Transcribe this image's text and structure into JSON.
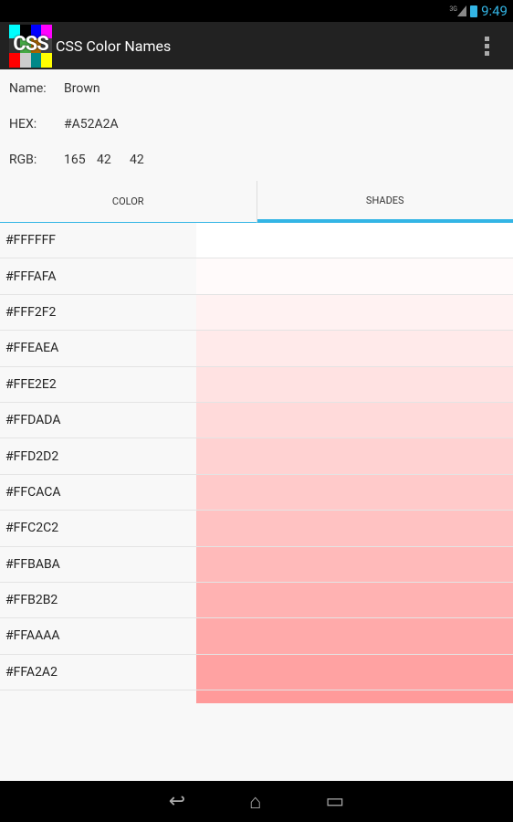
{
  "status": {
    "network": "3G",
    "time": "9:49"
  },
  "app": {
    "title": "CSS Color Names",
    "logo_text": "CSS"
  },
  "info": {
    "name_label": "Name:",
    "name": "Brown",
    "hex_label": "HEX:",
    "hex": "#A52A2A",
    "rgb_label": "RGB:",
    "r": "165",
    "g": "42",
    "b": "42"
  },
  "tabs": [
    {
      "label": "COLOR",
      "active": false
    },
    {
      "label": "SHADES",
      "active": true
    }
  ],
  "accent": "#33b5e5",
  "shades": [
    "#FFFFFF",
    "#FFFAFA",
    "#FFF2F2",
    "#FFEAEA",
    "#FFE2E2",
    "#FFDADA",
    "#FFD2D2",
    "#FFCACA",
    "#FFC2C2",
    "#FFBABA",
    "#FFB2B2",
    "#FFAAAA",
    "#FFA2A2"
  ],
  "partial_shade_color": "#FF9A9A"
}
